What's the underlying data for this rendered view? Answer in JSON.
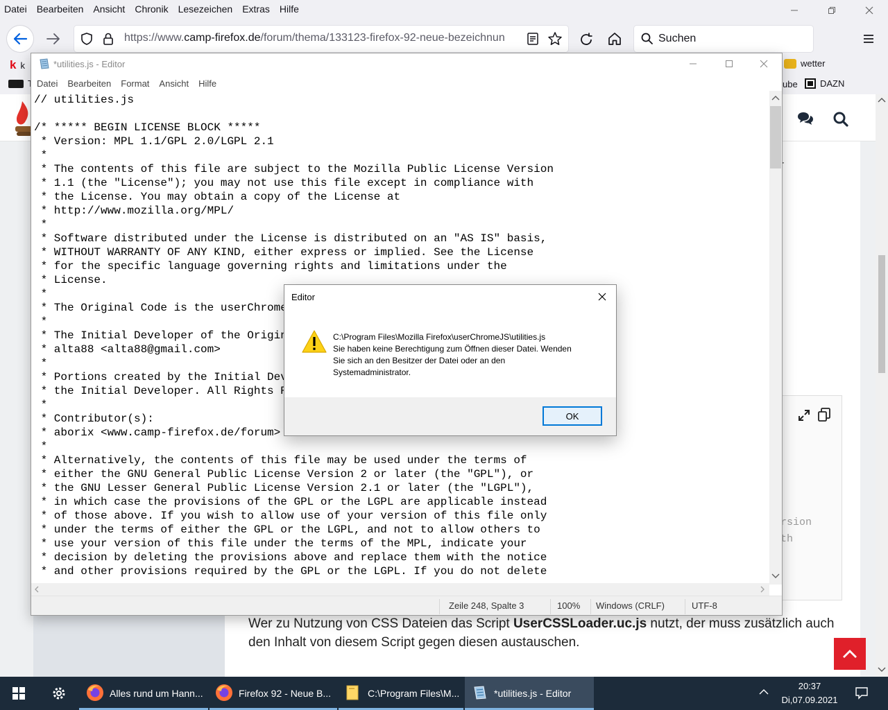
{
  "firefox": {
    "menu": [
      "Datei",
      "Bearbeiten",
      "Ansicht",
      "Chronik",
      "Lesezeichen",
      "Extras",
      "Hilfe"
    ],
    "url_prefix": "https://www.",
    "url_host": "camp-firefox.de",
    "url_path": "/forum/thema/133123-firefox-92-neue-bezeichnun",
    "search_placeholder": "Suchen",
    "bookmarks": {
      "left_1": "k",
      "left_2": "T",
      "right_1": "wetter",
      "right_2": "ube",
      "right_3": "DAZN"
    }
  },
  "webpage": {
    "text_before": "Wer zu Nutzung von CSS Dateien das Script ",
    "text_bold": "UserCSSLoader.uc.js",
    "text_after": " nutzt, der muss zusätzlich auch den Inhalt von diesem Script gegen diesen austauschen.",
    "code_fragment_1": "rsion",
    "code_fragment_2": "th",
    "side_fragment": "r"
  },
  "notepad": {
    "title": "*utilities.js - Editor",
    "menu": [
      "Datei",
      "Bearbeiten",
      "Format",
      "Ansicht",
      "Hilfe"
    ],
    "code": "// utilities.js\n\n/* ***** BEGIN LICENSE BLOCK *****\n * Version: MPL 1.1/GPL 2.0/LGPL 2.1\n *\n * The contents of this file are subject to the Mozilla Public License Version\n * 1.1 (the \"License\"); you may not use this file except in compliance with\n * the License. You may obtain a copy of the License at\n * http://www.mozilla.org/MPL/\n *\n * Software distributed under the License is distributed on an \"AS IS\" basis,\n * WITHOUT WARRANTY OF ANY KIND, either express or implied. See the License\n * for the specific language governing rights and limitations under the\n * License.\n *\n * The Original Code is the userChromeJS\n *\n * The Initial Developer of the Original\n * alta88 <alta88@gmail.com>\n *\n * Portions created by the Initial Devel\n * the Initial Developer. All Rights Res\n *\n * Contributor(s):\n * aborix <www.camp-firefox.de/forum>\n *\n * Alternatively, the contents of this file may be used under the terms of\n * either the GNU General Public License Version 2 or later (the \"GPL\"), or\n * the GNU Lesser General Public License Version 2.1 or later (the \"LGPL\"),\n * in which case the provisions of the GPL or the LGPL are applicable instead\n * of those above. If you wish to allow use of your version of this file only\n * under the terms of either the GPL or the LGPL, and not to allow others to\n * use your version of this file under the terms of the MPL, indicate your\n * decision by deleting the provisions above and replace them with the notice\n * and other provisions required by the GPL or the LGPL. If you do not delete",
    "status": {
      "position": "Zeile 248, Spalte 3",
      "zoom": "100%",
      "line_endings": "Windows (CRLF)",
      "encoding": "UTF-8"
    }
  },
  "dialog": {
    "title": "Editor",
    "path": "C:\\Program Files\\Mozilla Firefox\\userChromeJS\\utilities.js",
    "message_line1": "Sie haben keine Berechtigung zum Öffnen dieser Datei. Wenden",
    "message_line2": "Sie sich an den Besitzer der Datei oder an den",
    "message_line3": "Systemadministrator.",
    "ok_label": "OK",
    "icon": "warning-icon"
  },
  "taskbar": {
    "apps": [
      {
        "label": "Alles rund um Hann...",
        "icon": "firefox-icon"
      },
      {
        "label": "Firefox 92 - Neue B...",
        "icon": "firefox-icon"
      },
      {
        "label": "C:\\Program Files\\M...",
        "icon": "folder-icon"
      },
      {
        "label": "*utilities.js - Editor",
        "icon": "notepad-icon"
      }
    ],
    "time": "20:37",
    "date": "Di,07.09.2021"
  },
  "colors": {
    "accent_blue": "#0060df",
    "firefox_toolbar": "#f0f0f4",
    "taskbar": "#1c2b3a",
    "warning_yellow": "#fcd116",
    "red_button": "#e0202a"
  }
}
